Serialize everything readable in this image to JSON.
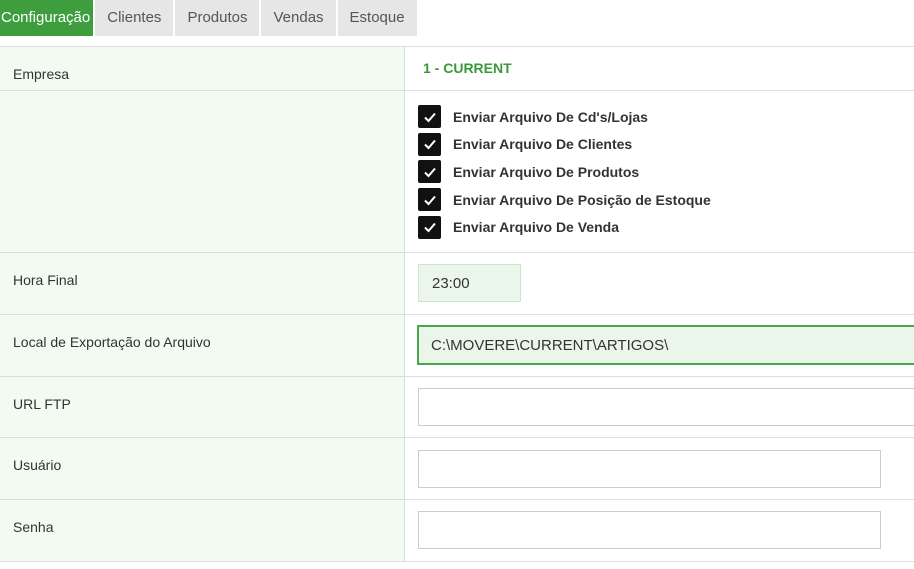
{
  "tabs": [
    {
      "label": "Configuração",
      "active": true
    },
    {
      "label": "Clientes"
    },
    {
      "label": "Produtos"
    },
    {
      "label": "Vendas"
    },
    {
      "label": "Estoque"
    }
  ],
  "form": {
    "empresa": {
      "label": "Empresa",
      "value": "1 - CURRENT"
    },
    "checks": [
      {
        "label": "Enviar Arquivo De Cd's/Lojas",
        "checked": true
      },
      {
        "label": "Enviar Arquivo De Clientes",
        "checked": true
      },
      {
        "label": "Enviar Arquivo De Produtos",
        "checked": true
      },
      {
        "label": "Enviar Arquivo De Posição de Estoque",
        "checked": true
      },
      {
        "label": "Enviar Arquivo De Venda",
        "checked": true
      }
    ],
    "hora_final": {
      "label": "Hora Final",
      "value": "23:00"
    },
    "local_exportacao": {
      "label": "Local de Exportação do Arquivo",
      "value": "C:\\MOVERE\\CURRENT\\ARTIGOS\\"
    },
    "url_ftp": {
      "label": "URL FTP",
      "value": ""
    },
    "usuario": {
      "label": "Usuário",
      "value": ""
    },
    "senha": {
      "label": "Senha",
      "value": ""
    }
  },
  "colors": {
    "accent": "#3e9e3e",
    "label_bg": "#f2fbf2",
    "checkbox": "#111111"
  },
  "icons": {
    "checkbox": "check-icon"
  }
}
